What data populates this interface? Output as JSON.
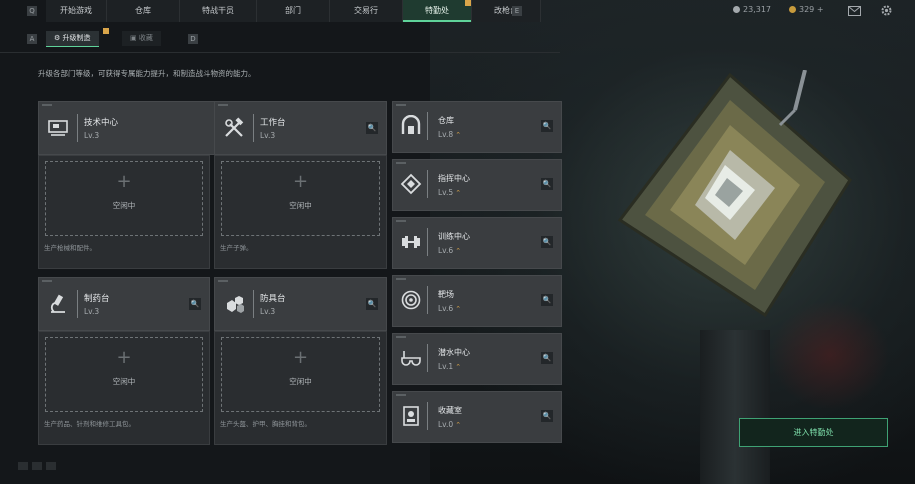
{
  "nav": {
    "tabs": [
      {
        "label": "开始游戏"
      },
      {
        "label": "仓库"
      },
      {
        "label": "特战干员"
      },
      {
        "label": "部门"
      },
      {
        "label": "交易行"
      },
      {
        "label": "特勤处"
      },
      {
        "label": "改枪台"
      }
    ],
    "key_left": "Q",
    "key_right": "E",
    "currency_silver": "23,317",
    "currency_gold": "329 +"
  },
  "subtabs": {
    "key_left": "A",
    "key_right": "D",
    "active_label": "升级制造",
    "inactive_label": "收藏"
  },
  "description": "升级各部门等级，可获得专属能力提升，和制造战斗物资的能力。",
  "workshops": [
    {
      "name": "技术中心",
      "level": "Lv.3",
      "icon": "monitor-icon",
      "slot_status": "空闲中",
      "slot_desc": "生产枪械和配件。"
    },
    {
      "name": "工作台",
      "level": "Lv.3",
      "icon": "tools-icon",
      "slot_status": "空闲中",
      "slot_desc": "生产子弹。"
    },
    {
      "name": "制药台",
      "level": "Lv.3",
      "icon": "microscope-icon",
      "slot_status": "空闲中",
      "slot_desc": "生产药品、针剂和维修工具包。"
    },
    {
      "name": "防具台",
      "level": "Lv.3",
      "icon": "armor-icon",
      "slot_status": "空闲中",
      "slot_desc": "生产头盔、护甲、胸挂和背包。"
    }
  ],
  "facilities": [
    {
      "name": "仓库",
      "level": "Lv.8",
      "icon": "warehouse-icon"
    },
    {
      "name": "指挥中心",
      "level": "Lv.5",
      "icon": "command-icon"
    },
    {
      "name": "训练中心",
      "level": "Lv.6",
      "icon": "dumbbell-icon"
    },
    {
      "name": "靶场",
      "level": "Lv.6",
      "icon": "target-icon"
    },
    {
      "name": "潜水中心",
      "level": "Lv.1",
      "icon": "diving-mask-icon"
    },
    {
      "name": "收藏室",
      "level": "Lv.0",
      "icon": "collection-icon"
    }
  ],
  "enter_button": "进入特勤处",
  "colors": {
    "accent": "#5fd39a",
    "upgrade": "#d9a54a"
  }
}
